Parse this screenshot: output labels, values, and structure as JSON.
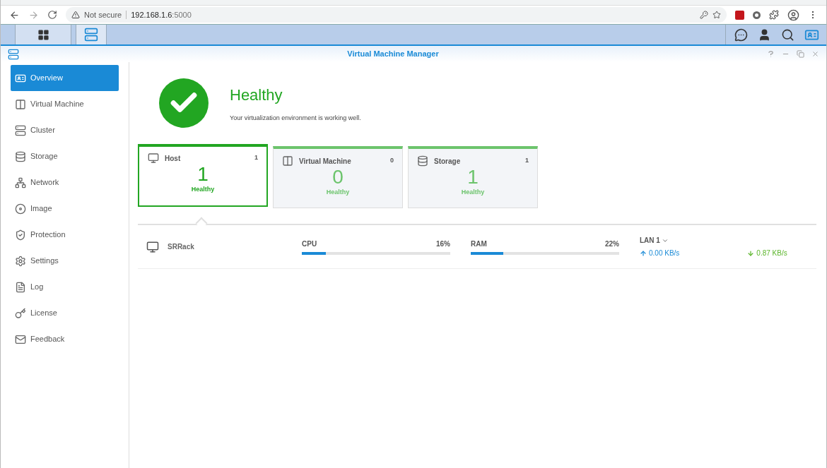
{
  "browser": {
    "security": "Not secure",
    "host": "192.168.1.6",
    "port": ":5000"
  },
  "window": {
    "title": "Virtual Machine Manager"
  },
  "sidebar": {
    "items": [
      {
        "label": "Overview",
        "selected": true
      },
      {
        "label": "Virtual Machine",
        "selected": false
      },
      {
        "label": "Cluster",
        "selected": false
      },
      {
        "label": "Storage",
        "selected": false
      },
      {
        "label": "Network",
        "selected": false
      },
      {
        "label": "Image",
        "selected": false
      },
      {
        "label": "Protection",
        "selected": false
      },
      {
        "label": "Settings",
        "selected": false
      },
      {
        "label": "Log",
        "selected": false
      },
      {
        "label": "License",
        "selected": false
      },
      {
        "label": "Feedback",
        "selected": false
      }
    ]
  },
  "status": {
    "title": "Healthy",
    "message": "Your virtualization environment is working well."
  },
  "cards": [
    {
      "label": "Host",
      "count": "1",
      "value": "1",
      "status": "Healthy",
      "selected": true
    },
    {
      "label": "Virtual Machine",
      "count": "0",
      "value": "0",
      "status": "Healthy",
      "selected": false
    },
    {
      "label": "Storage",
      "count": "1",
      "value": "1",
      "status": "Healthy",
      "selected": false
    }
  ],
  "hosts": [
    {
      "name": "SRRack",
      "cpu": {
        "label": "CPU",
        "reading": "16%",
        "level": 0.16
      },
      "ram": {
        "label": "RAM",
        "reading": "22%",
        "level": 0.22
      },
      "lan": {
        "label": "LAN 1",
        "up": "0.00 KB/s",
        "down": "0.87 KB/s"
      }
    }
  ]
}
